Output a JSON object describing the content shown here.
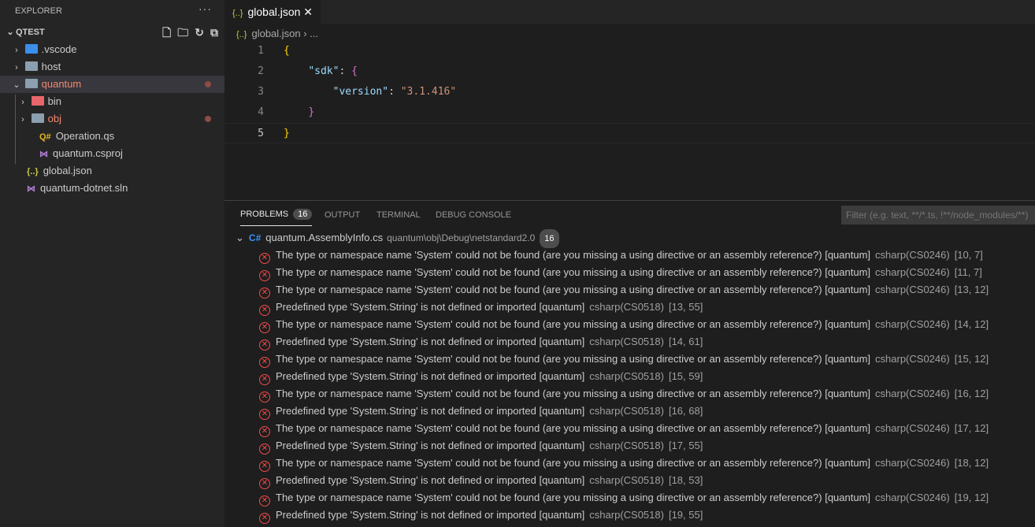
{
  "sidebar": {
    "title": "EXPLORER",
    "more": "···",
    "section": "QTEST",
    "items": [
      {
        "label": ".vscode",
        "indent": 0,
        "chev": "›",
        "color": "#3b8eea",
        "type": "folder"
      },
      {
        "label": "host",
        "indent": 0,
        "chev": "›",
        "color": "#8b9fae",
        "type": "folder"
      },
      {
        "label": "quantum",
        "indent": 0,
        "chev": "⌄",
        "color": "#8b9fae",
        "type": "folder",
        "red": true,
        "dot": true,
        "selected": true
      },
      {
        "label": "bin",
        "indent": 1,
        "chev": "›",
        "color": "#e8666a",
        "type": "folder"
      },
      {
        "label": "obj",
        "indent": 1,
        "chev": "›",
        "color": "#8b9fae",
        "type": "folder",
        "red": true,
        "dot": true
      },
      {
        "label": "Operation.qs",
        "indent": 1,
        "icon": "Q#",
        "iconColor": "#e8b923"
      },
      {
        "label": "quantum.csproj",
        "indent": 1,
        "icon": "⋈",
        "iconColor": "#b180d7"
      },
      {
        "label": "global.json",
        "indent": 0,
        "icon": "{..}",
        "iconColor": "#cbcb41"
      },
      {
        "label": "quantum-dotnet.sln",
        "indent": 0,
        "icon": "⋈",
        "iconColor": "#b180d7"
      }
    ]
  },
  "tab": {
    "label": "global.json",
    "icon": "{..}",
    "close": "✕"
  },
  "breadcrumb": {
    "icon": "{..}",
    "file": "global.json",
    "rest": "› ..."
  },
  "editor": {
    "lines": [
      [
        {
          "t": "{",
          "c": "y"
        }
      ],
      [
        {
          "t": "    "
        },
        {
          "t": "\"sdk\"",
          "c": "k"
        },
        {
          "t": ": "
        },
        {
          "t": "{",
          "c": "p"
        }
      ],
      [
        {
          "t": "        "
        },
        {
          "t": "\"version\"",
          "c": "k"
        },
        {
          "t": ": "
        },
        {
          "t": "\"3.1.416\"",
          "c": "s"
        }
      ],
      [
        {
          "t": "    "
        },
        {
          "t": "}",
          "c": "p"
        }
      ],
      [
        {
          "t": "}",
          "c": "y"
        }
      ]
    ]
  },
  "panel": {
    "tabs": [
      "PROBLEMS",
      "OUTPUT",
      "TERMINAL",
      "DEBUG CONSOLE"
    ],
    "problems_count": "16",
    "filter_placeholder": "Filter (e.g. text, **/*.ts, !**/node_modules/**)",
    "file": {
      "name": "quantum.AssemblyInfo.cs",
      "path": "quantum\\obj\\Debug\\netstandard2.0",
      "count": "16",
      "icon": "C#"
    },
    "problems": [
      {
        "msg": "The type or namespace name 'System' could not be found (are you missing a using directive or an assembly reference?) [quantum]",
        "src": "csharp(CS0246)",
        "loc": "[10, 7]"
      },
      {
        "msg": "The type or namespace name 'System' could not be found (are you missing a using directive or an assembly reference?) [quantum]",
        "src": "csharp(CS0246)",
        "loc": "[11, 7]"
      },
      {
        "msg": "The type or namespace name 'System' could not be found (are you missing a using directive or an assembly reference?) [quantum]",
        "src": "csharp(CS0246)",
        "loc": "[13, 12]"
      },
      {
        "msg": "Predefined type 'System.String' is not defined or imported [quantum]",
        "src": "csharp(CS0518)",
        "loc": "[13, 55]"
      },
      {
        "msg": "The type or namespace name 'System' could not be found (are you missing a using directive or an assembly reference?) [quantum]",
        "src": "csharp(CS0246)",
        "loc": "[14, 12]"
      },
      {
        "msg": "Predefined type 'System.String' is not defined or imported [quantum]",
        "src": "csharp(CS0518)",
        "loc": "[14, 61]"
      },
      {
        "msg": "The type or namespace name 'System' could not be found (are you missing a using directive or an assembly reference?) [quantum]",
        "src": "csharp(CS0246)",
        "loc": "[15, 12]"
      },
      {
        "msg": "Predefined type 'System.String' is not defined or imported [quantum]",
        "src": "csharp(CS0518)",
        "loc": "[15, 59]"
      },
      {
        "msg": "The type or namespace name 'System' could not be found (are you missing a using directive or an assembly reference?) [quantum]",
        "src": "csharp(CS0246)",
        "loc": "[16, 12]"
      },
      {
        "msg": "Predefined type 'System.String' is not defined or imported [quantum]",
        "src": "csharp(CS0518)",
        "loc": "[16, 68]"
      },
      {
        "msg": "The type or namespace name 'System' could not be found (are you missing a using directive or an assembly reference?) [quantum]",
        "src": "csharp(CS0246)",
        "loc": "[17, 12]"
      },
      {
        "msg": "Predefined type 'System.String' is not defined or imported [quantum]",
        "src": "csharp(CS0518)",
        "loc": "[17, 55]"
      },
      {
        "msg": "The type or namespace name 'System' could not be found (are you missing a using directive or an assembly reference?) [quantum]",
        "src": "csharp(CS0246)",
        "loc": "[18, 12]"
      },
      {
        "msg": "Predefined type 'System.String' is not defined or imported [quantum]",
        "src": "csharp(CS0518)",
        "loc": "[18, 53]"
      },
      {
        "msg": "The type or namespace name 'System' could not be found (are you missing a using directive or an assembly reference?) [quantum]",
        "src": "csharp(CS0246)",
        "loc": "[19, 12]"
      },
      {
        "msg": "Predefined type 'System.String' is not defined or imported [quantum]",
        "src": "csharp(CS0518)",
        "loc": "[19, 55]"
      }
    ]
  }
}
